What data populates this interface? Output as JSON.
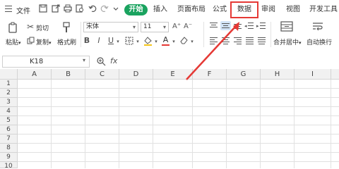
{
  "topbar": {
    "file_label": "文件",
    "tabs": [
      "开始",
      "插入",
      "页面布局",
      "公式",
      "数据",
      "审阅",
      "视图",
      "开发工具"
    ],
    "highlighted_tab": "数据",
    "quick_access_icons": [
      "save-icon",
      "export-icon",
      "print-icon",
      "preview-icon",
      "undo-icon",
      "redo-icon",
      "more-icon"
    ]
  },
  "ribbon": {
    "paste_label": "粘贴",
    "cut_label": "剪切",
    "copy_label": "复制",
    "format_painter_label": "格式刷",
    "font_name": "宋体",
    "font_size": "11",
    "font_grow": "A⁺",
    "font_shrink": "A⁻",
    "bold": "B",
    "italic": "I",
    "underline": "U",
    "font_color": "A",
    "merge_label": "合并居中",
    "wrap_label": "自动换行"
  },
  "formula_bar": {
    "cell_ref": "K18",
    "fx_label": "fx"
  },
  "grid": {
    "columns": [
      "A",
      "B",
      "C",
      "D",
      "E",
      "F",
      "G",
      "H",
      "I"
    ],
    "rows": [
      "1",
      "2",
      "3",
      "4",
      "5",
      "6",
      "7",
      "8",
      "9",
      "10"
    ]
  },
  "colors": {
    "accent_green": "#1aa35f",
    "annotation_red": "#e53935",
    "header_bg": "#f1f1f1"
  }
}
